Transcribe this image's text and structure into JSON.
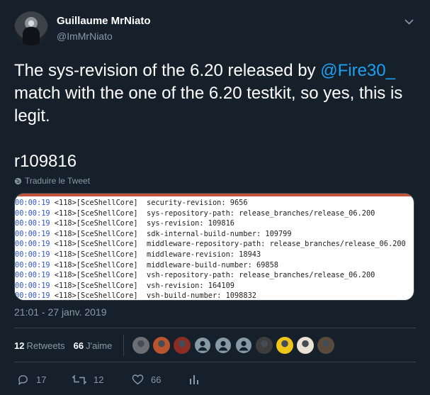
{
  "author": {
    "name": "Guillaume MrNiato",
    "handle": "@ImMrNiato"
  },
  "tweet": {
    "text_before": "The sys-revision of the 6.20 released by ",
    "mention": "@Fire30_",
    "text_after": " match with the one of the 6.20 testkit, so yes, this is legit.\n\nr109816",
    "translate_label": "Traduire le Tweet"
  },
  "code_lines": [
    {
      "ts": "00:00:19",
      "text": " <118>[SceShellCore]  security-revision: 9656"
    },
    {
      "ts": "00:00:19",
      "text": " <118>[SceShellCore]  sys-repository-path: release_branches/release_06.200"
    },
    {
      "ts": "00:00:19",
      "text": " <118>[SceShellCore]  sys-revision: 109816"
    },
    {
      "ts": "00:00:19",
      "text": " <118>[SceShellCore]  sdk-internal-build-number: 109799"
    },
    {
      "ts": "00:00:19",
      "text": " <118>[SceShellCore]  middleware-repository-path: release_branches/release_06.200"
    },
    {
      "ts": "00:00:19",
      "text": " <118>[SceShellCore]  middleware-revision: 18943"
    },
    {
      "ts": "00:00:19",
      "text": " <118>[SceShellCore]  middleware-build-number: 69858"
    },
    {
      "ts": "00:00:19",
      "text": " <118>[SceShellCore]  vsh-repository-path: release_branches/release_06.200"
    },
    {
      "ts": "00:00:19",
      "text": " <118>[SceShellCore]  vsh-revision: 164109"
    },
    {
      "ts": "00:00:19",
      "text": " <118>[SceShellCore]  vsh-build-number: 1098832"
    }
  ],
  "timestamp": "21:01 - 27 janv. 2019",
  "stats": {
    "retweets_count": "12",
    "retweets_label": "Retweets",
    "likes_count": "66",
    "likes_label": "J'aime"
  },
  "liker_avatars": [
    {
      "icon": "wolf-avatar",
      "color": "#6b6f74"
    },
    {
      "icon": "redhead-avatar",
      "color": "#b9542e"
    },
    {
      "icon": "hand-avatar",
      "color": "#8a2d24"
    },
    {
      "icon": "default-egg-avatar",
      "color": "#8899a6"
    },
    {
      "icon": "default-egg-avatar",
      "color": "#8899a6"
    },
    {
      "icon": "default-egg-avatar",
      "color": "#8899a6"
    },
    {
      "icon": "person-avatar",
      "color": "#3d3d3d"
    },
    {
      "icon": "emoji-avatar",
      "color": "#f0c419"
    },
    {
      "icon": "cartoon-avatar",
      "color": "#e9e2d5"
    },
    {
      "icon": "portrait-avatar",
      "color": "#5a4a3c"
    }
  ],
  "actions": {
    "reply_count": "17",
    "retweet_count": "12",
    "like_count": "66"
  },
  "colors": {
    "background": "#15202b",
    "accent": "#1da1f2",
    "muted": "#8899a6",
    "divider": "#38444d"
  }
}
